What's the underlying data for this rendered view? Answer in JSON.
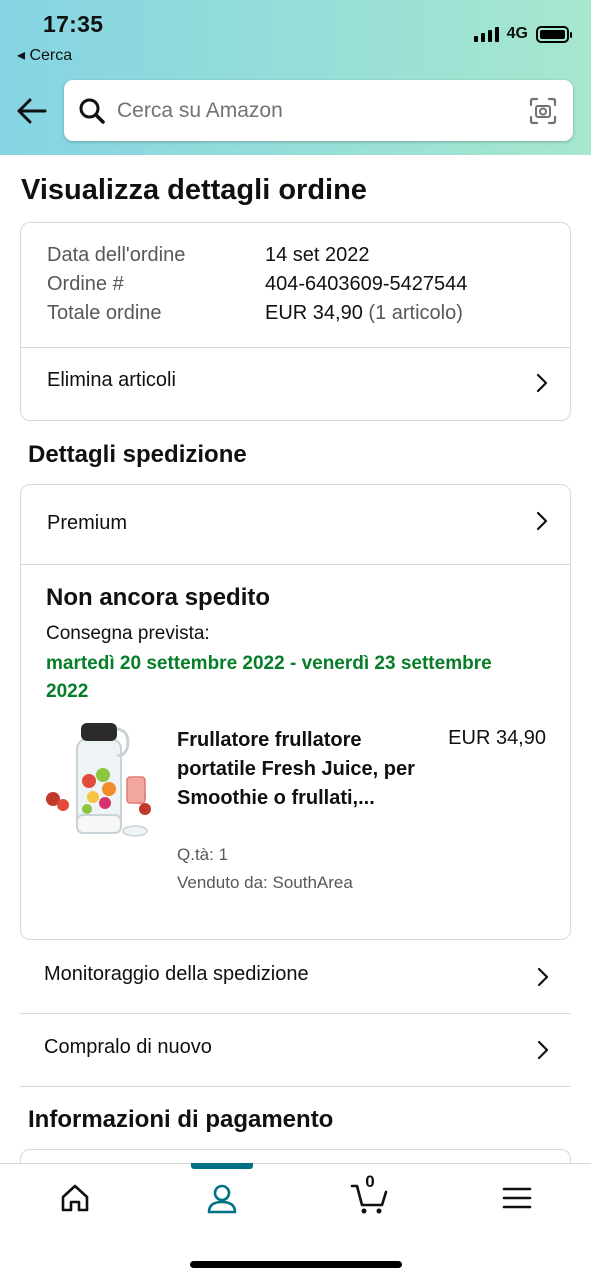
{
  "status_bar": {
    "time": "17:35",
    "back_app": "◂ Cerca",
    "network": "4G"
  },
  "search": {
    "placeholder": "Cerca su Amazon"
  },
  "page_title": "Visualizza dettagli ordine",
  "order_info": {
    "rows": [
      {
        "label": "Data dell'ordine",
        "value": "14 set 2022"
      },
      {
        "label": "Ordine #",
        "value": "404-6403609-5427544"
      },
      {
        "label": "Totale ordine",
        "value": "EUR 34,90",
        "extra": "(1 articolo)"
      }
    ],
    "delete_items": "Elimina articoli"
  },
  "shipping": {
    "section_title": "Dettagli spedizione",
    "speed": "Premium",
    "status": "Non ancora spedito",
    "delivery_label": "Consegna prevista:",
    "delivery_date": "martedì 20 settembre 2022 - venerdì 23 settembre 2022",
    "product": {
      "name": "Frullatore frullatore portatile Fresh Juice, per Smoothie o frullati,...",
      "price": "EUR 34,90",
      "quantity": "Q.tà: 1",
      "seller": "Venduto da: SouthArea"
    }
  },
  "actions": {
    "track": "Monitoraggio della spedizione",
    "buy_again": "Compralo di nuovo"
  },
  "payment": {
    "section_title": "Informazioni di pagamento"
  },
  "tabbar": {
    "cart_count": "0",
    "active_tab": "account"
  },
  "colors": {
    "header_gradient_start": "#85d4e3",
    "header_gradient_end": "#a6e7ce",
    "delivery_green": "#067d28",
    "active_tab": "#007185",
    "border": "#d5d9d9"
  }
}
